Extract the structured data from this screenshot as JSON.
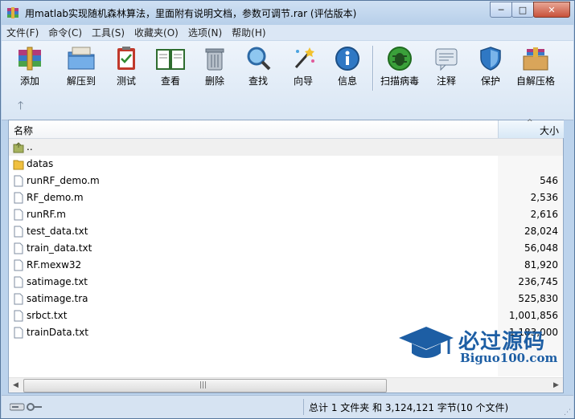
{
  "window": {
    "title": "用matlab实现随机森林算法，里面附有说明文档，参数可调节.rar (评估版本)"
  },
  "menu": [
    "文件(F)",
    "命令(C)",
    "工具(S)",
    "收藏夹(O)",
    "选项(N)",
    "帮助(H)"
  ],
  "toolbar": {
    "add": "添加",
    "extract_to": "解压到",
    "test": "测试",
    "view": "查看",
    "delete": "删除",
    "find": "查找",
    "wizard": "向导",
    "info": "信息",
    "virus_scan": "扫描病毒",
    "comment": "注释",
    "protect": "保护",
    "sfx": "自解压格"
  },
  "list": {
    "col_name": "名称",
    "col_size": "大小",
    "rows": [
      {
        "name": "..",
        "size": "",
        "type": "parent"
      },
      {
        "name": "datas",
        "size": "",
        "type": "folder"
      },
      {
        "name": "runRF_demo.m",
        "size": "546",
        "type": "file"
      },
      {
        "name": "RF_demo.m",
        "size": "2,536",
        "type": "file"
      },
      {
        "name": "runRF.m",
        "size": "2,616",
        "type": "file"
      },
      {
        "name": "test_data.txt",
        "size": "28,024",
        "type": "file"
      },
      {
        "name": "train_data.txt",
        "size": "56,048",
        "type": "file"
      },
      {
        "name": "RF.mexw32",
        "size": "81,920",
        "type": "file"
      },
      {
        "name": "satimage.txt",
        "size": "236,745",
        "type": "file"
      },
      {
        "name": "satimage.tra",
        "size": "525,830",
        "type": "file"
      },
      {
        "name": "srbct.txt",
        "size": "1,001,856",
        "type": "file"
      },
      {
        "name": "trainData.txt",
        "size": "1,183,000",
        "type": "file"
      }
    ]
  },
  "status": {
    "text": "总计 1 文件夹 和 3,124,121 字节(10 个文件)"
  },
  "watermark": {
    "brand": "必过源码",
    "domain": "Biguo100.com"
  },
  "colors": {
    "accent": "#1d5ea4",
    "title_bg": "#bcd3ec"
  }
}
